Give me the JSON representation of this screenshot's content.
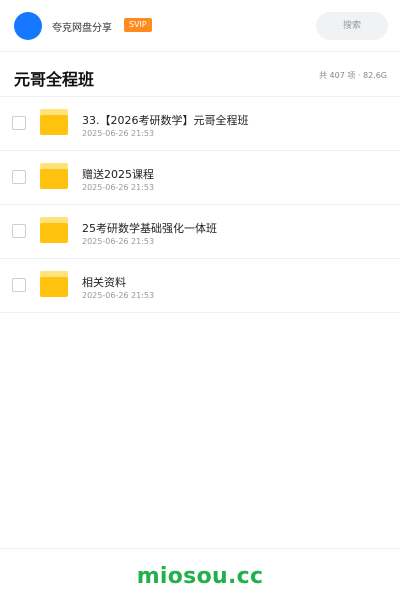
{
  "header": {
    "user_name": "夸克网盘分享",
    "badge": "SVIP",
    "search_placeholder": "搜索",
    "avatar_color": "#1677ff",
    "badge_color": "#ff8a1f"
  },
  "folder": {
    "title": "元哥全程班",
    "summary": "共 407 项 · 82.6G"
  },
  "items": [
    {
      "name": "33.【2026考研数学】元哥全程班",
      "date": "2025-06-26 21:53",
      "icon": "folder-icon"
    },
    {
      "name": "赠送2025课程",
      "date": "2025-06-26 21:53",
      "icon": "folder-icon"
    },
    {
      "name": "25考研数学基础强化一体班",
      "date": "2025-06-26 21:53",
      "icon": "folder-icon"
    },
    {
      "name": "相关资料",
      "date": "2025-06-26 21:53",
      "icon": "folder-icon"
    }
  ],
  "footer": {
    "watermark": "miosou.cc",
    "watermark_color": "#22b04c"
  }
}
